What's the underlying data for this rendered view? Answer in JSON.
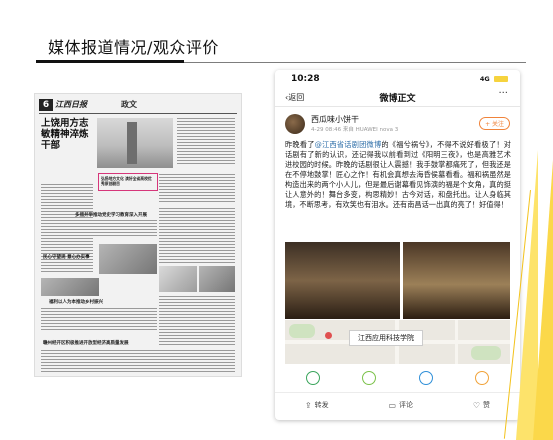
{
  "slide": {
    "title": "媒体报道情况/观众评价"
  },
  "newspaper": {
    "page_number": "6",
    "brand": "江西日报",
    "section": "政文",
    "headline": "上饶用方志敏精神淬炼干部",
    "highlight_title": "弘扬地方文化 演好全省高校优秀原创剧目",
    "subheads": [
      "多措并举推动党史学习教育深入开展",
      "民心守望观 意心办实事",
      "福利以人为本推动乡村振兴",
      "赣州经开区积极推进开放型经济高质量发展"
    ]
  },
  "phone": {
    "time": "10:28",
    "signal": "4G",
    "back_label": "返回",
    "nav_title": "微博正文",
    "more_label": "···",
    "user": {
      "name": "西瓜味小饼干",
      "meta": "4-29 08:46 来自 HUAWEI nova 3"
    },
    "follow_label": "+ 关注",
    "post": {
      "prefix": "昨晚看了",
      "mention": "@江西省话剧团微博",
      "body": "的《福兮祸兮》，不得不说好看极了！对话剧有了新的认识，还记得我以前看到过《阳明三夜》，也是高雅艺术进校园的时候。昨晚的话剧很让人震撼！我手鼓掌都痛死了，但我还是在不停地鼓掌！匠心之作！有机会真想去海昏侯墓看看。福和祸虽然是构造出来的两个小人儿，但是最后谢幕看见饰演的福是个女角，真的挺让人意外的！舞台多变，构思精妙！古今对话，和盘托出。让人身临其境，不断思考，有欢笑也有泪水。还有南昌话一出真的亮了！好值得！"
    },
    "map_label": "江西应用科技学院",
    "actions": {
      "repost": "转发",
      "comment": "评论",
      "like": "赞"
    },
    "reaction_colors": [
      "#3ba55c",
      "#7cc24b",
      "#2f8fd8",
      "#f1a33a"
    ]
  }
}
